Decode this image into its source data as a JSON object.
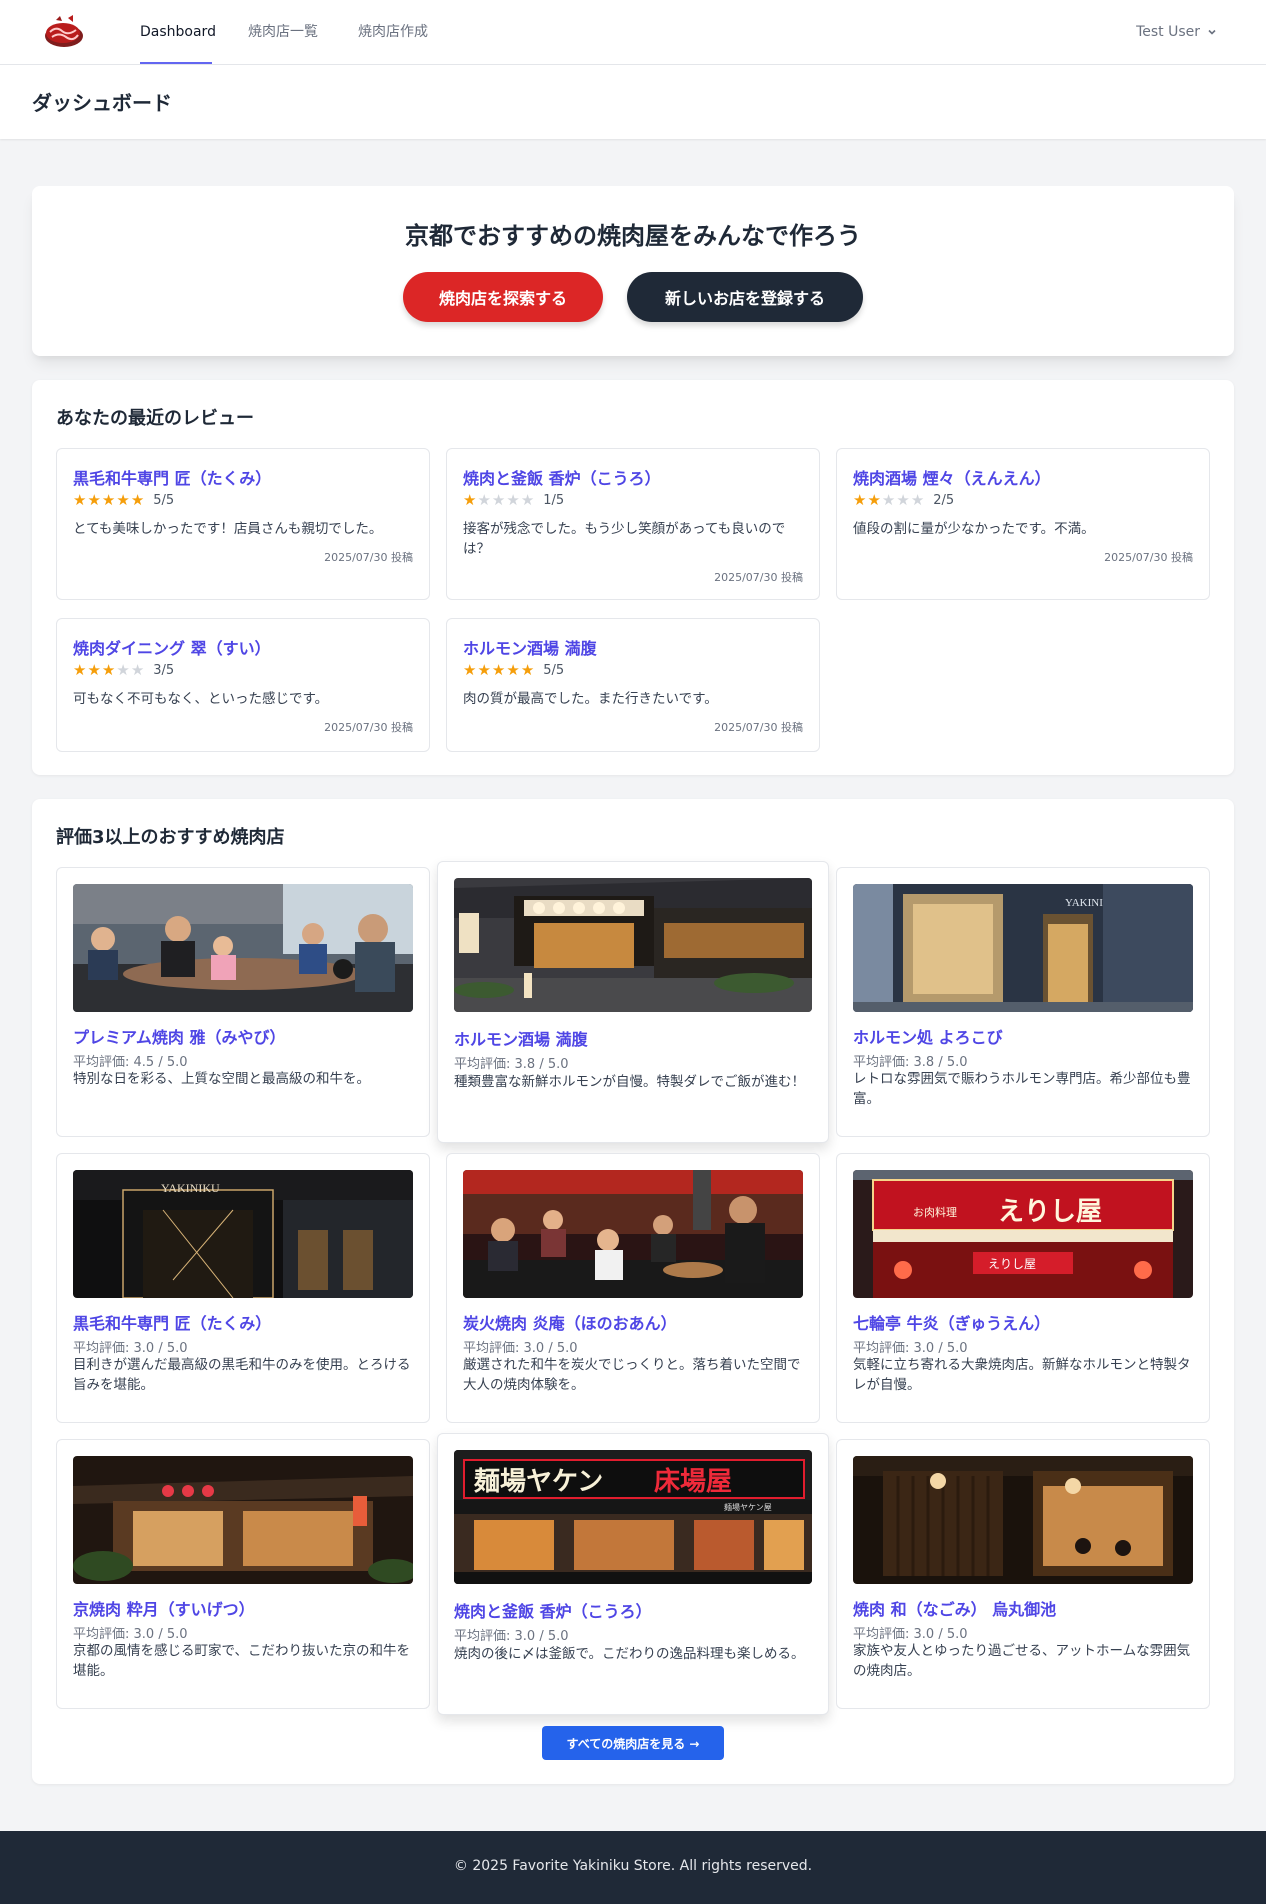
{
  "nav": {
    "links": [
      "Dashboard",
      "焼肉店一覧",
      "焼肉店作成"
    ],
    "user": "Test User"
  },
  "page_title": "ダッシュボード",
  "hero": {
    "title": "京都でおすすめの焼肉屋をみんなで作ろう",
    "explore_label": "焼肉店を探索する",
    "register_label": "新しいお店を登録する"
  },
  "reviews": {
    "title": "あなたの最近のレビュー",
    "items": [
      {
        "name": "黒毛和牛専門 匠（たくみ）",
        "rating": 5,
        "score": "5/5",
        "comment": "とても美味しかったです！店員さんも親切でした。",
        "date": "2025/07/30 投稿"
      },
      {
        "name": "焼肉と釜飯 香炉（こうろ）",
        "rating": 1,
        "score": "1/5",
        "comment": "接客が残念でした。もう少し笑顔があっても良いのでは？",
        "date": "2025/07/30 投稿"
      },
      {
        "name": "焼肉酒場 煙々（えんえん）",
        "rating": 2,
        "score": "2/5",
        "comment": "値段の割に量が少なかったです。不満。",
        "date": "2025/07/30 投稿"
      },
      {
        "name": "焼肉ダイニング 翠（すい）",
        "rating": 3,
        "score": "3/5",
        "comment": "可もなく不可もなく、といった感じです。",
        "date": "2025/07/30 投稿"
      },
      {
        "name": "ホルモン酒場 満腹",
        "rating": 5,
        "score": "5/5",
        "comment": "肉の質が最高でした。また行きたいです。",
        "date": "2025/07/30 投稿"
      }
    ]
  },
  "recommended": {
    "title": "評価3以上のおすすめ焼肉店",
    "stores": [
      {
        "name": "プレミアム焼肉 雅（みやび）",
        "rating": "平均評価: 4.5 / 5.0",
        "desc": "特別な日を彩る、上質な空間と最高級の和牛を。"
      },
      {
        "name": "ホルモン酒場 満腹",
        "rating": "平均評価: 3.8 / 5.0",
        "desc": "種類豊富な新鮮ホルモンが自慢。特製ダレでご飯が進む！"
      },
      {
        "name": "ホルモン処 よろこび",
        "rating": "平均評価: 3.8 / 5.0",
        "desc": "レトロな雰囲気で賑わうホルモン専門店。希少部位も豊富。"
      },
      {
        "name": "黒毛和牛専門 匠（たくみ）",
        "rating": "平均評価: 3.0 / 5.0",
        "desc": "目利きが選んだ最高級の黒毛和牛のみを使用。とろける旨みを堪能。"
      },
      {
        "name": "炭火焼肉 炎庵（ほのおあん）",
        "rating": "平均評価: 3.0 / 5.0",
        "desc": "厳選された和牛を炭火でじっくりと。落ち着いた空間で大人の焼肉体験を。"
      },
      {
        "name": "七輪亭 牛炎（ぎゅうえん）",
        "rating": "平均評価: 3.0 / 5.0",
        "desc": "気軽に立ち寄れる大衆焼肉店。新鮮なホルモンと特製タレが自慢。"
      },
      {
        "name": "京焼肉 粋月（すいげつ）",
        "rating": "平均評価: 3.0 / 5.0",
        "desc": "京都の風情を感じる町家で、こだわり抜いた京の和牛を堪能。"
      },
      {
        "name": "焼肉と釜飯 香炉（こうろ）",
        "rating": "平均評価: 3.0 / 5.0",
        "desc": "焼肉の後に〆は釜飯で。こだわりの逸品料理も楽しめる。"
      },
      {
        "name": "焼肉 和（なごみ） 烏丸御池",
        "rating": "平均評価: 3.0 / 5.0",
        "desc": "家族や友人とゆったり過ごせる、アットホームな雰囲気の焼肉店。"
      }
    ],
    "all_label": "すべての焼肉店を見る →",
    "image_texts": {
      "yakiniku": "YAKINIKU",
      "sign_small": "お肉料理",
      "sign_big": "えりし屋",
      "sign_curtain": "えりし屋",
      "neon_left": "麺場ヤケン",
      "neon_right": "床場屋",
      "neon_sub": "麺場ヤケン屋"
    }
  },
  "footer": "© 2025 Favorite Yakiniku Store. All rights reserved.",
  "colors": {
    "accent": "#4f46e5",
    "red": "#dc2626",
    "dark": "#1f2937",
    "blue": "#2563eb",
    "star": "#f59e0b"
  }
}
